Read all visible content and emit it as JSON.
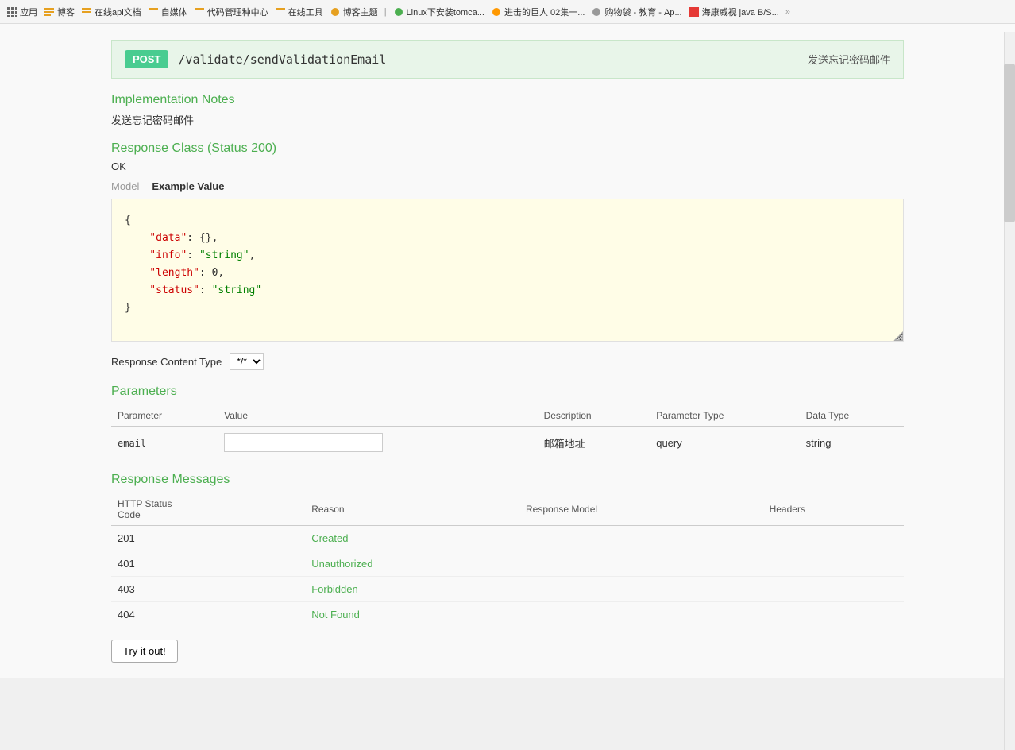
{
  "browser": {
    "tabs": [
      {
        "label": "应用",
        "icon": "grid"
      },
      {
        "label": "博客",
        "icon": "folder"
      },
      {
        "label": "在线api文档",
        "icon": "folder"
      },
      {
        "label": "自媒体",
        "icon": "folder"
      },
      {
        "label": "代码管理种中心",
        "icon": "folder"
      },
      {
        "label": "在线工具",
        "icon": "folder"
      },
      {
        "label": "博客主题",
        "icon": "folder"
      },
      {
        "label": "Linux下安装tomca...",
        "icon": "tab",
        "active": false
      },
      {
        "label": "进击的巨人 02集一...",
        "icon": "tab",
        "active": false
      },
      {
        "label": "购物袋 - 教育 - Ap...",
        "icon": "tab",
        "active": false
      },
      {
        "label": "海康威视 java B/S...",
        "icon": "tab",
        "active": true
      }
    ]
  },
  "api": {
    "method": "POST",
    "path": "/validate/sendValidationEmail",
    "title": "发送忘记密码邮件",
    "implementation_notes_label": "Implementation Notes",
    "implementation_notes_value": "发送忘记密码邮件",
    "response_class_label": "Response Class (Status 200)",
    "response_class_value": "OK",
    "model_label": "Model",
    "example_value_label": "Example Value",
    "json_code": {
      "line1": "{",
      "line2_key": "\"data\"",
      "line2_val": "{}",
      "line3_key": "\"info\"",
      "line3_val": "\"string\"",
      "line4_key": "\"length\"",
      "line4_val": "0",
      "line5_key": "\"status\"",
      "line5_val": "\"string\"",
      "line6": "}"
    },
    "response_content_type_label": "Response Content Type",
    "response_content_type_value": "*/*",
    "parameters_label": "Parameters",
    "parameters_columns": {
      "parameter": "Parameter",
      "value": "Value",
      "description": "Description",
      "parameter_type": "Parameter Type",
      "data_type": "Data Type"
    },
    "parameters": [
      {
        "name": "email",
        "value": "",
        "description": "邮箱地址",
        "parameter_type": "query",
        "data_type": "string"
      }
    ],
    "response_messages_label": "Response Messages",
    "response_columns": {
      "http_status_code": "HTTP Status Code",
      "reason": "Reason",
      "response_model": "Response Model",
      "headers": "Headers"
    },
    "response_messages": [
      {
        "code": "201",
        "reason": "Created"
      },
      {
        "code": "401",
        "reason": "Unauthorized"
      },
      {
        "code": "403",
        "reason": "Forbidden"
      },
      {
        "code": "404",
        "reason": "Not Found"
      }
    ],
    "try_button_label": "Try it out!"
  }
}
